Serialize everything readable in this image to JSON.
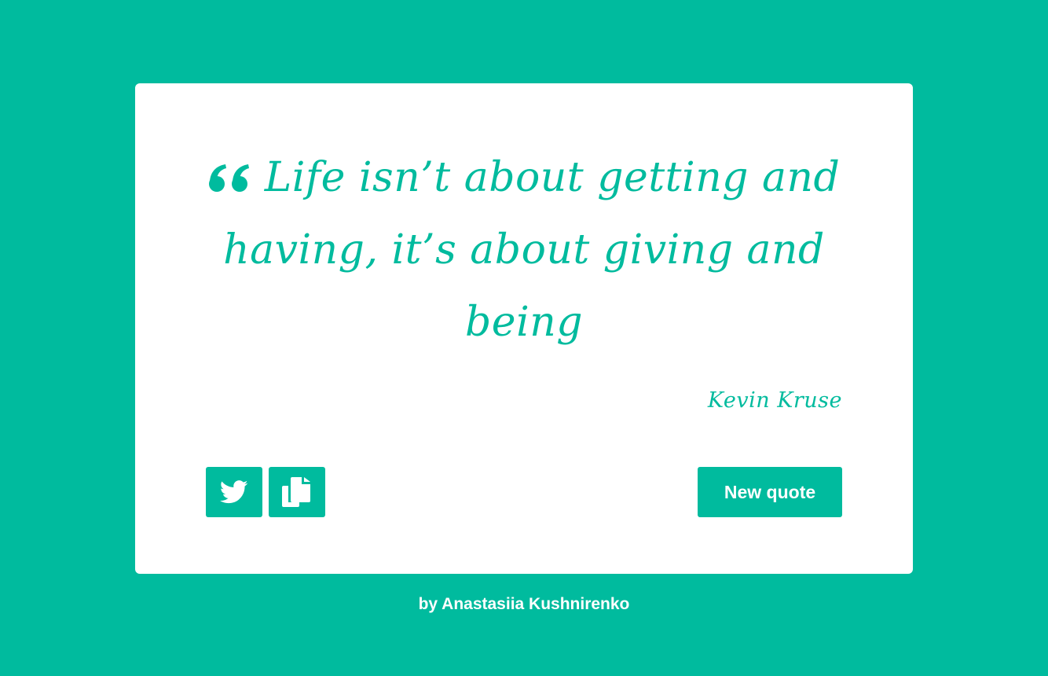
{
  "theme": {
    "accent_color": "#00bb9e",
    "card_color": "#ffffff",
    "text_on_accent": "#ffffff"
  },
  "quote": {
    "icon": "quote-left-icon",
    "text": "Life isn’t about getting and having, it’s about giving and being",
    "author": "Kevin Kruse"
  },
  "actions": {
    "tweet_icon": "twitter-icon",
    "copy_icon": "copy-icon",
    "new_quote_label": "New quote"
  },
  "footer": {
    "credit": "by Anastasiia Kushnirenko"
  }
}
